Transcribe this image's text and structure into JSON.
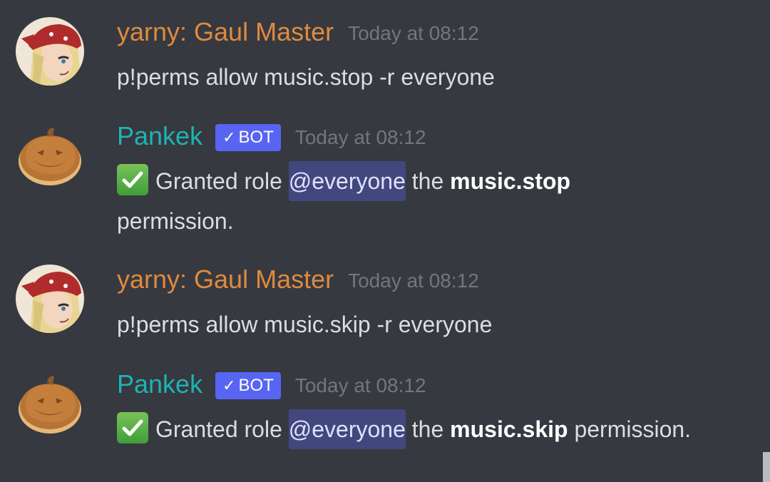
{
  "messages": [
    {
      "author": "yarny: Gaul Master",
      "timestamp": "Today at 08:12",
      "content": "p!perms allow music.stop -r everyone",
      "avatar_icon": "anime-character-bandana-avatar"
    },
    {
      "author": "Pankek",
      "bot_tag": "BOT",
      "timestamp": "Today at 08:12",
      "content_prefix": "Granted role",
      "mention": "@everyone",
      "content_the": "the",
      "permission": "music.stop",
      "content_suffix": "permission.",
      "avatar_icon": "pumpkin-pancake-avatar",
      "emoji": "white-check-mark-icon"
    },
    {
      "author": "yarny: Gaul Master",
      "timestamp": "Today at 08:12",
      "content": "p!perms allow music.skip -r everyone",
      "avatar_icon": "anime-character-bandana-avatar"
    },
    {
      "author": "Pankek",
      "bot_tag": "BOT",
      "timestamp": "Today at 08:12",
      "content_prefix": "Granted role",
      "mention": "@everyone",
      "content_the": "the",
      "permission": "music.skip",
      "content_suffix": "permission.",
      "avatar_icon": "pumpkin-pancake-avatar",
      "emoji": "white-check-mark-icon"
    }
  ],
  "colors": {
    "background": "#36393f",
    "user_name": "#e08a3e",
    "bot_name": "#1fb3b3",
    "bot_tag": "#5865f2",
    "timestamp": "#72767d",
    "mention_bg": "#4a4f8a"
  }
}
